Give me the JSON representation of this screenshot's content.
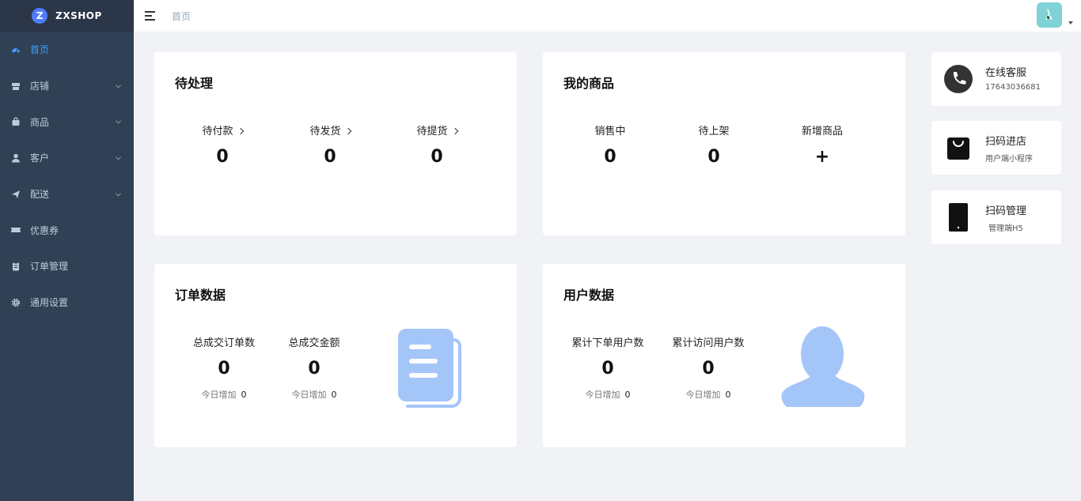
{
  "app": {
    "logo_letter": "Z",
    "name": "ZXSHOP"
  },
  "sidebar": {
    "items": [
      {
        "label": "首页",
        "icon": "dashboard-icon",
        "active": true
      },
      {
        "label": "店铺",
        "icon": "store-icon",
        "expandable": true
      },
      {
        "label": "商品",
        "icon": "shopping-bag-icon",
        "expandable": true
      },
      {
        "label": "客户",
        "icon": "user-icon",
        "expandable": true
      },
      {
        "label": "配送",
        "icon": "send-icon",
        "expandable": true
      },
      {
        "label": "优惠券",
        "icon": "ticket-icon"
      },
      {
        "label": "订单管理",
        "icon": "clipboard-icon"
      },
      {
        "label": "通用设置",
        "icon": "gear-icon"
      }
    ]
  },
  "header": {
    "breadcrumb": "首页"
  },
  "pending": {
    "title": "待处理",
    "stats": [
      {
        "label": "待付款",
        "value": "0"
      },
      {
        "label": "待发货",
        "value": "0"
      },
      {
        "label": "待提货",
        "value": "0"
      }
    ]
  },
  "products": {
    "title": "我的商品",
    "stats": [
      {
        "label": "销售中",
        "value": "0"
      },
      {
        "label": "待上架",
        "value": "0"
      },
      {
        "label": "新增商品",
        "value": "+"
      }
    ]
  },
  "orders": {
    "title": "订单数据",
    "stats": [
      {
        "label": "总成交订单数",
        "value": "0",
        "sub_label": "今日增加",
        "sub_value": "0"
      },
      {
        "label": "总成交金额",
        "value": "0",
        "sub_label": "今日增加",
        "sub_value": "0"
      }
    ]
  },
  "users": {
    "title": "用户数据",
    "stats": [
      {
        "label": "累计下单用户数",
        "value": "0",
        "sub_label": "今日增加",
        "sub_value": "0"
      },
      {
        "label": "累计访问用户数",
        "value": "0",
        "sub_label": "今日增加",
        "sub_value": "0"
      }
    ]
  },
  "shortcuts": [
    {
      "title": "在线客服",
      "sub": "17643036681",
      "icon": "phone-icon"
    },
    {
      "title": "扫码进店",
      "sub": "用户端小程序",
      "icon": "shopping-bag-icon"
    },
    {
      "title": "扫码管理",
      "sub": "管理端H5",
      "icon": "mobile-icon"
    }
  ],
  "colors": {
    "sidebar_bg": "#304156",
    "accent": "#409eff",
    "illustration": "#a4c5f8"
  }
}
